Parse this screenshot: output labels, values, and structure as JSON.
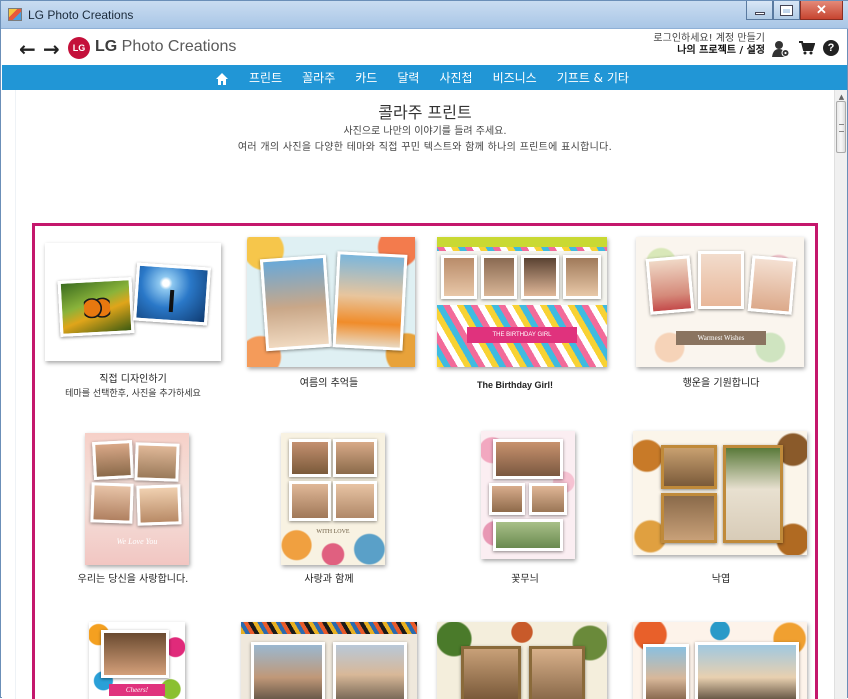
{
  "window": {
    "title": "LG Photo Creations"
  },
  "header": {
    "brand_logo": "LG",
    "brand_name": "Photo Creations",
    "login_text": "로그인하세요! 계정 만들기",
    "projects_text": "나의 프로젝트 / 설정",
    "help_label": "?"
  },
  "menu": {
    "items": [
      "프린트",
      "꼴라주",
      "카드",
      "달력",
      "사진첩",
      "비즈니스",
      "기프트 & 기타"
    ]
  },
  "page": {
    "title": "콜라주 프린트",
    "subtitle1": "사진으로 나만의 이야기를 들려 주세요.",
    "subtitle2": "여러 개의 사진을 다양한 테마와 직접 꾸민 텍스트와 함께 하나의 프린트에 표시합니다."
  },
  "templates": [
    {
      "caption": "직접 디자인하기",
      "subcaption": "테마를 선택한후, 사진을 추가하세요"
    },
    {
      "caption": "여름의 추억들"
    },
    {
      "caption": "The Birthday Girl!",
      "banner": "THE BIRTHDAY GIRL"
    },
    {
      "caption": "행운을 기원합니다",
      "banner": "Warmest Wishes"
    },
    {
      "caption": "우리는 당신을 사랑합니다.",
      "banner": "We Love You"
    },
    {
      "caption": "사랑과 함께",
      "banner": "WITH LOVE"
    },
    {
      "caption": "꽃무늬"
    },
    {
      "caption": "낙엽"
    },
    {
      "caption": "",
      "banner": "Cheers!"
    },
    {
      "caption": ""
    },
    {
      "caption": ""
    },
    {
      "caption": ""
    }
  ],
  "colors": {
    "menu_blue": "#2196d6",
    "frame_magenta": "#c4176c",
    "brand_red": "#c4103a"
  }
}
